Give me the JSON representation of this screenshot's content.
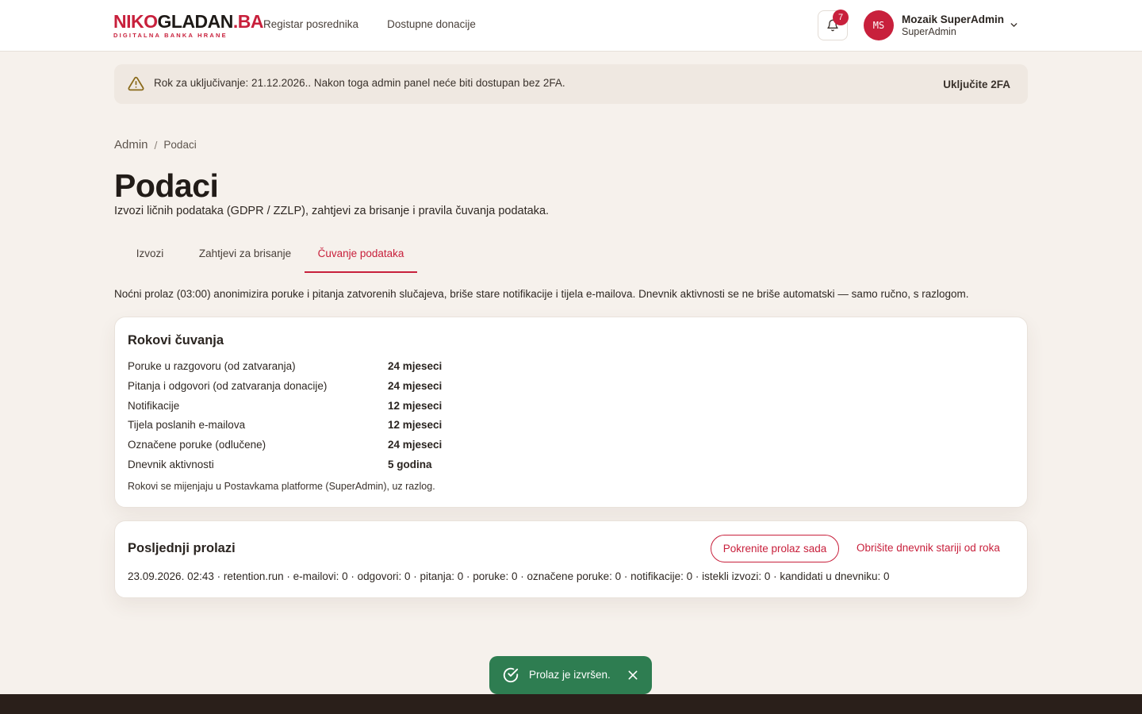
{
  "header": {
    "logo": {
      "part1": "NIKO",
      "part2": "GLADAN",
      "part3": ".BA",
      "tagline": "DIGITALNA BANKA HRANE"
    },
    "nav": [
      {
        "label": "Registar posrednika"
      },
      {
        "label": "Dostupne donacije"
      }
    ],
    "notifications_count": "7",
    "user": {
      "initials": "MS",
      "name": "Mozaik SuperAdmin",
      "role": "SuperAdmin"
    }
  },
  "banner": {
    "text": "Rok za uključivanje: 21.12.2026.. Nakon toga admin panel neće biti dostupan bez 2FA.",
    "action": "Uključite 2FA"
  },
  "breadcrumb": {
    "root": "Admin",
    "separator": "/",
    "current": "Podaci"
  },
  "page": {
    "title": "Podaci",
    "subtitle": "Izvozi ličnih podataka (GDPR / ZZLP), zahtjevi za brisanje i pravila čuvanja podataka."
  },
  "tabs": [
    {
      "label": "Izvozi"
    },
    {
      "label": "Zahtjevi za brisanje"
    },
    {
      "label": "Čuvanje podataka",
      "active": true
    }
  ],
  "info_text": "Noćni prolaz (03:00) anonimizira poruke i pitanja zatvorenih slučajeva, briše stare notifikacije i tijela e-mailova. Dnevnik aktivnosti se ne briše automatski — samo ručno, s razlogom.",
  "retention": {
    "title": "Rokovi čuvanja",
    "rows": [
      {
        "label": "Poruke u razgovoru (od zatvaranja)",
        "value": "24 mjeseci"
      },
      {
        "label": "Pitanja i odgovori (od zatvaranja donacije)",
        "value": "24 mjeseci"
      },
      {
        "label": "Notifikacije",
        "value": "12 mjeseci"
      },
      {
        "label": "Tijela poslanih e-mailova",
        "value": "12 mjeseci"
      },
      {
        "label": "Označene poruke (odlučene)",
        "value": "24 mjeseci"
      },
      {
        "label": "Dnevnik aktivnosti",
        "value": "5 godina"
      }
    ],
    "note": "Rokovi se mijenjaju u Postavkama platforme (SuperAdmin), uz razlog."
  },
  "runs": {
    "title": "Posljednji prolazi",
    "run_button": "Pokrenite prolaz sada",
    "delete_button": "Obrišite dnevnik stariji od roka",
    "last_run": "23.09.2026. 02:43 · retention.run · e-mailovi: 0 · odgovori: 0 · pitanja: 0 · poruke: 0 · označene poruke: 0 · notifikacije: 0 · istekli izvozi: 0 · kandidati u dnevniku: 0"
  },
  "toast": {
    "text": "Prolaz je izvršen."
  },
  "colors": {
    "accent": "#c8203c",
    "success": "#2e7d51",
    "background": "#f6f1ec",
    "footer": "#2a1f1a"
  }
}
